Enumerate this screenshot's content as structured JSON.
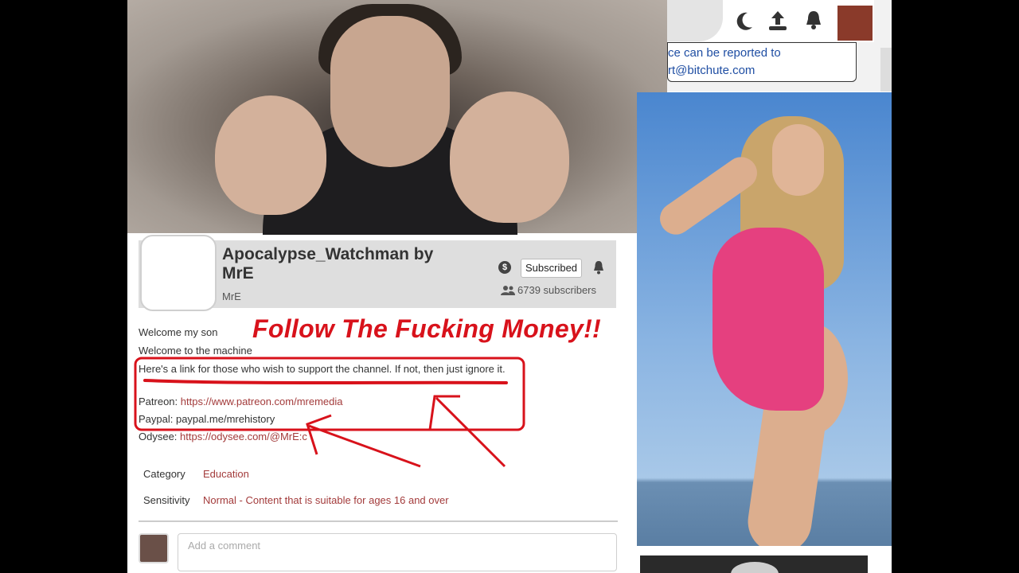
{
  "topbar": {
    "notice_line1": "ce can be reported to",
    "notice_line2": "rt@bitchute.com",
    "icons": [
      "moon-icon",
      "upload-icon",
      "bell-icon"
    ]
  },
  "channel": {
    "name": "Apocalypse_Watchman by MrE",
    "owner": "MrE",
    "subscribe_label": "Subscribed",
    "subscribers": "6739 subscribers"
  },
  "headline": "Follow The Fucking Money!!",
  "description": {
    "line1": "Welcome my son",
    "line2": "Welcome to the machine",
    "line3": "Here's a link for those who wish to support the channel. If not, then just ignore it.",
    "patreon_label": "Patreon: ",
    "patreon_url": "https://www.patreon.com/mremedia",
    "paypal_text": "Paypal: paypal.me/mrehistory",
    "odysee_label": "Odysee: ",
    "odysee_url": "https://odysee.com/@MrE:c"
  },
  "meta": {
    "category_label": "Category",
    "category_value": "Education",
    "sensitivity_label": "Sensitivity",
    "sensitivity_value": "Normal - Content that is suitable for ages 16 and over"
  },
  "comment": {
    "placeholder": "Add a comment"
  },
  "colors": {
    "link": "#a33b3b",
    "annotation_red": "#d8121b",
    "card_bg": "#dedede"
  }
}
